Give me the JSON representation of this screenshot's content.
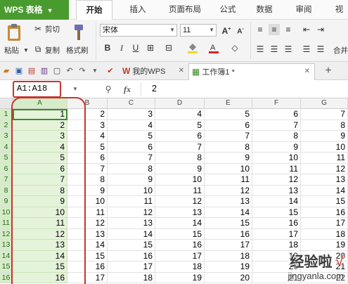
{
  "app": {
    "brand": "WPS 表格",
    "brand_color": "#4a9b2f",
    "selection_ring_color": "#c9342f"
  },
  "menu": {
    "tabs": [
      "开始",
      "插入",
      "页面布局",
      "公式",
      "数据",
      "审阅",
      "视"
    ],
    "active": "开始"
  },
  "ribbon": {
    "paste": "粘贴",
    "cut": "剪切",
    "copy": "复制",
    "format_painter": "格式刷",
    "font_name": "宋体",
    "font_size": "11",
    "merge_label": "合并"
  },
  "tabs": {
    "items": [
      {
        "label": "我的WPS",
        "active": false
      },
      {
        "label": "工作簿1 *",
        "active": true
      }
    ]
  },
  "formula_bar": {
    "name_box": "A1:A18",
    "fx": "fx",
    "value": "2"
  },
  "sheet": {
    "columns": [
      "A",
      "B",
      "C",
      "D",
      "E",
      "F",
      "G"
    ],
    "row_numbers": [
      "1",
      "2",
      "3",
      "4",
      "5",
      "6",
      "7",
      "8",
      "9",
      "10",
      "11",
      "12",
      "13",
      "14",
      "15",
      "16"
    ],
    "rows": [
      [
        "1",
        "2",
        "3",
        "4",
        "5",
        "6",
        "7"
      ],
      [
        "2",
        "3",
        "4",
        "5",
        "6",
        "7",
        "8"
      ],
      [
        "3",
        "4",
        "5",
        "6",
        "7",
        "8",
        "9"
      ],
      [
        "4",
        "5",
        "6",
        "7",
        "8",
        "9",
        "10"
      ],
      [
        "5",
        "6",
        "7",
        "8",
        "9",
        "10",
        "11"
      ],
      [
        "6",
        "7",
        "8",
        "9",
        "10",
        "11",
        "12"
      ],
      [
        "7",
        "8",
        "9",
        "10",
        "11",
        "12",
        "13"
      ],
      [
        "8",
        "9",
        "10",
        "11",
        "12",
        "13",
        "14"
      ],
      [
        "9",
        "10",
        "11",
        "12",
        "13",
        "14",
        "15"
      ],
      [
        "10",
        "11",
        "12",
        "13",
        "14",
        "15",
        "16"
      ],
      [
        "11",
        "12",
        "13",
        "14",
        "15",
        "16",
        "17"
      ],
      [
        "12",
        "13",
        "14",
        "15",
        "16",
        "17",
        "18"
      ],
      [
        "13",
        "14",
        "15",
        "16",
        "17",
        "18",
        "19"
      ],
      [
        "14",
        "15",
        "16",
        "17",
        "18",
        "19",
        "20"
      ],
      [
        "15",
        "16",
        "17",
        "18",
        "19",
        "20",
        "21"
      ],
      [
        "16",
        "17",
        "18",
        "19",
        "20",
        "21",
        "22"
      ]
    ]
  },
  "watermark": {
    "cn": "经验啦",
    "check": "√",
    "en": "jingyanla.com"
  }
}
